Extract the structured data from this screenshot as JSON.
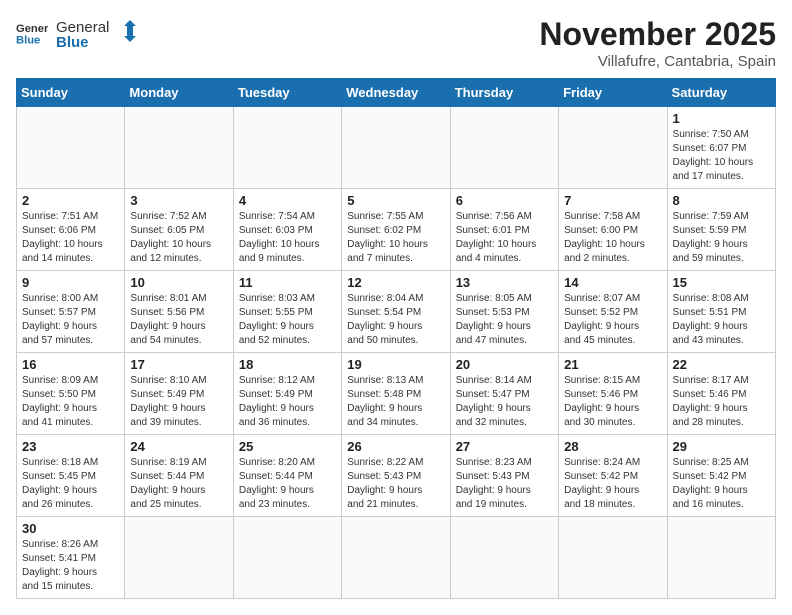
{
  "header": {
    "logo_general": "General",
    "logo_blue": "Blue",
    "month_title": "November 2025",
    "location": "Villafufre, Cantabria, Spain"
  },
  "days_of_week": [
    "Sunday",
    "Monday",
    "Tuesday",
    "Wednesday",
    "Thursday",
    "Friday",
    "Saturday"
  ],
  "weeks": [
    [
      {
        "day": "",
        "info": ""
      },
      {
        "day": "",
        "info": ""
      },
      {
        "day": "",
        "info": ""
      },
      {
        "day": "",
        "info": ""
      },
      {
        "day": "",
        "info": ""
      },
      {
        "day": "",
        "info": ""
      },
      {
        "day": "1",
        "info": "Sunrise: 7:50 AM\nSunset: 6:07 PM\nDaylight: 10 hours\nand 17 minutes."
      }
    ],
    [
      {
        "day": "2",
        "info": "Sunrise: 7:51 AM\nSunset: 6:06 PM\nDaylight: 10 hours\nand 14 minutes."
      },
      {
        "day": "3",
        "info": "Sunrise: 7:52 AM\nSunset: 6:05 PM\nDaylight: 10 hours\nand 12 minutes."
      },
      {
        "day": "4",
        "info": "Sunrise: 7:54 AM\nSunset: 6:03 PM\nDaylight: 10 hours\nand 9 minutes."
      },
      {
        "day": "5",
        "info": "Sunrise: 7:55 AM\nSunset: 6:02 PM\nDaylight: 10 hours\nand 7 minutes."
      },
      {
        "day": "6",
        "info": "Sunrise: 7:56 AM\nSunset: 6:01 PM\nDaylight: 10 hours\nand 4 minutes."
      },
      {
        "day": "7",
        "info": "Sunrise: 7:58 AM\nSunset: 6:00 PM\nDaylight: 10 hours\nand 2 minutes."
      },
      {
        "day": "8",
        "info": "Sunrise: 7:59 AM\nSunset: 5:59 PM\nDaylight: 9 hours\nand 59 minutes."
      }
    ],
    [
      {
        "day": "9",
        "info": "Sunrise: 8:00 AM\nSunset: 5:57 PM\nDaylight: 9 hours\nand 57 minutes."
      },
      {
        "day": "10",
        "info": "Sunrise: 8:01 AM\nSunset: 5:56 PM\nDaylight: 9 hours\nand 54 minutes."
      },
      {
        "day": "11",
        "info": "Sunrise: 8:03 AM\nSunset: 5:55 PM\nDaylight: 9 hours\nand 52 minutes."
      },
      {
        "day": "12",
        "info": "Sunrise: 8:04 AM\nSunset: 5:54 PM\nDaylight: 9 hours\nand 50 minutes."
      },
      {
        "day": "13",
        "info": "Sunrise: 8:05 AM\nSunset: 5:53 PM\nDaylight: 9 hours\nand 47 minutes."
      },
      {
        "day": "14",
        "info": "Sunrise: 8:07 AM\nSunset: 5:52 PM\nDaylight: 9 hours\nand 45 minutes."
      },
      {
        "day": "15",
        "info": "Sunrise: 8:08 AM\nSunset: 5:51 PM\nDaylight: 9 hours\nand 43 minutes."
      }
    ],
    [
      {
        "day": "16",
        "info": "Sunrise: 8:09 AM\nSunset: 5:50 PM\nDaylight: 9 hours\nand 41 minutes."
      },
      {
        "day": "17",
        "info": "Sunrise: 8:10 AM\nSunset: 5:49 PM\nDaylight: 9 hours\nand 39 minutes."
      },
      {
        "day": "18",
        "info": "Sunrise: 8:12 AM\nSunset: 5:49 PM\nDaylight: 9 hours\nand 36 minutes."
      },
      {
        "day": "19",
        "info": "Sunrise: 8:13 AM\nSunset: 5:48 PM\nDaylight: 9 hours\nand 34 minutes."
      },
      {
        "day": "20",
        "info": "Sunrise: 8:14 AM\nSunset: 5:47 PM\nDaylight: 9 hours\nand 32 minutes."
      },
      {
        "day": "21",
        "info": "Sunrise: 8:15 AM\nSunset: 5:46 PM\nDaylight: 9 hours\nand 30 minutes."
      },
      {
        "day": "22",
        "info": "Sunrise: 8:17 AM\nSunset: 5:46 PM\nDaylight: 9 hours\nand 28 minutes."
      }
    ],
    [
      {
        "day": "23",
        "info": "Sunrise: 8:18 AM\nSunset: 5:45 PM\nDaylight: 9 hours\nand 26 minutes."
      },
      {
        "day": "24",
        "info": "Sunrise: 8:19 AM\nSunset: 5:44 PM\nDaylight: 9 hours\nand 25 minutes."
      },
      {
        "day": "25",
        "info": "Sunrise: 8:20 AM\nSunset: 5:44 PM\nDaylight: 9 hours\nand 23 minutes."
      },
      {
        "day": "26",
        "info": "Sunrise: 8:22 AM\nSunset: 5:43 PM\nDaylight: 9 hours\nand 21 minutes."
      },
      {
        "day": "27",
        "info": "Sunrise: 8:23 AM\nSunset: 5:43 PM\nDaylight: 9 hours\nand 19 minutes."
      },
      {
        "day": "28",
        "info": "Sunrise: 8:24 AM\nSunset: 5:42 PM\nDaylight: 9 hours\nand 18 minutes."
      },
      {
        "day": "29",
        "info": "Sunrise: 8:25 AM\nSunset: 5:42 PM\nDaylight: 9 hours\nand 16 minutes."
      }
    ],
    [
      {
        "day": "30",
        "info": "Sunrise: 8:26 AM\nSunset: 5:41 PM\nDaylight: 9 hours\nand 15 minutes."
      },
      {
        "day": "",
        "info": ""
      },
      {
        "day": "",
        "info": ""
      },
      {
        "day": "",
        "info": ""
      },
      {
        "day": "",
        "info": ""
      },
      {
        "day": "",
        "info": ""
      },
      {
        "day": "",
        "info": ""
      }
    ]
  ]
}
